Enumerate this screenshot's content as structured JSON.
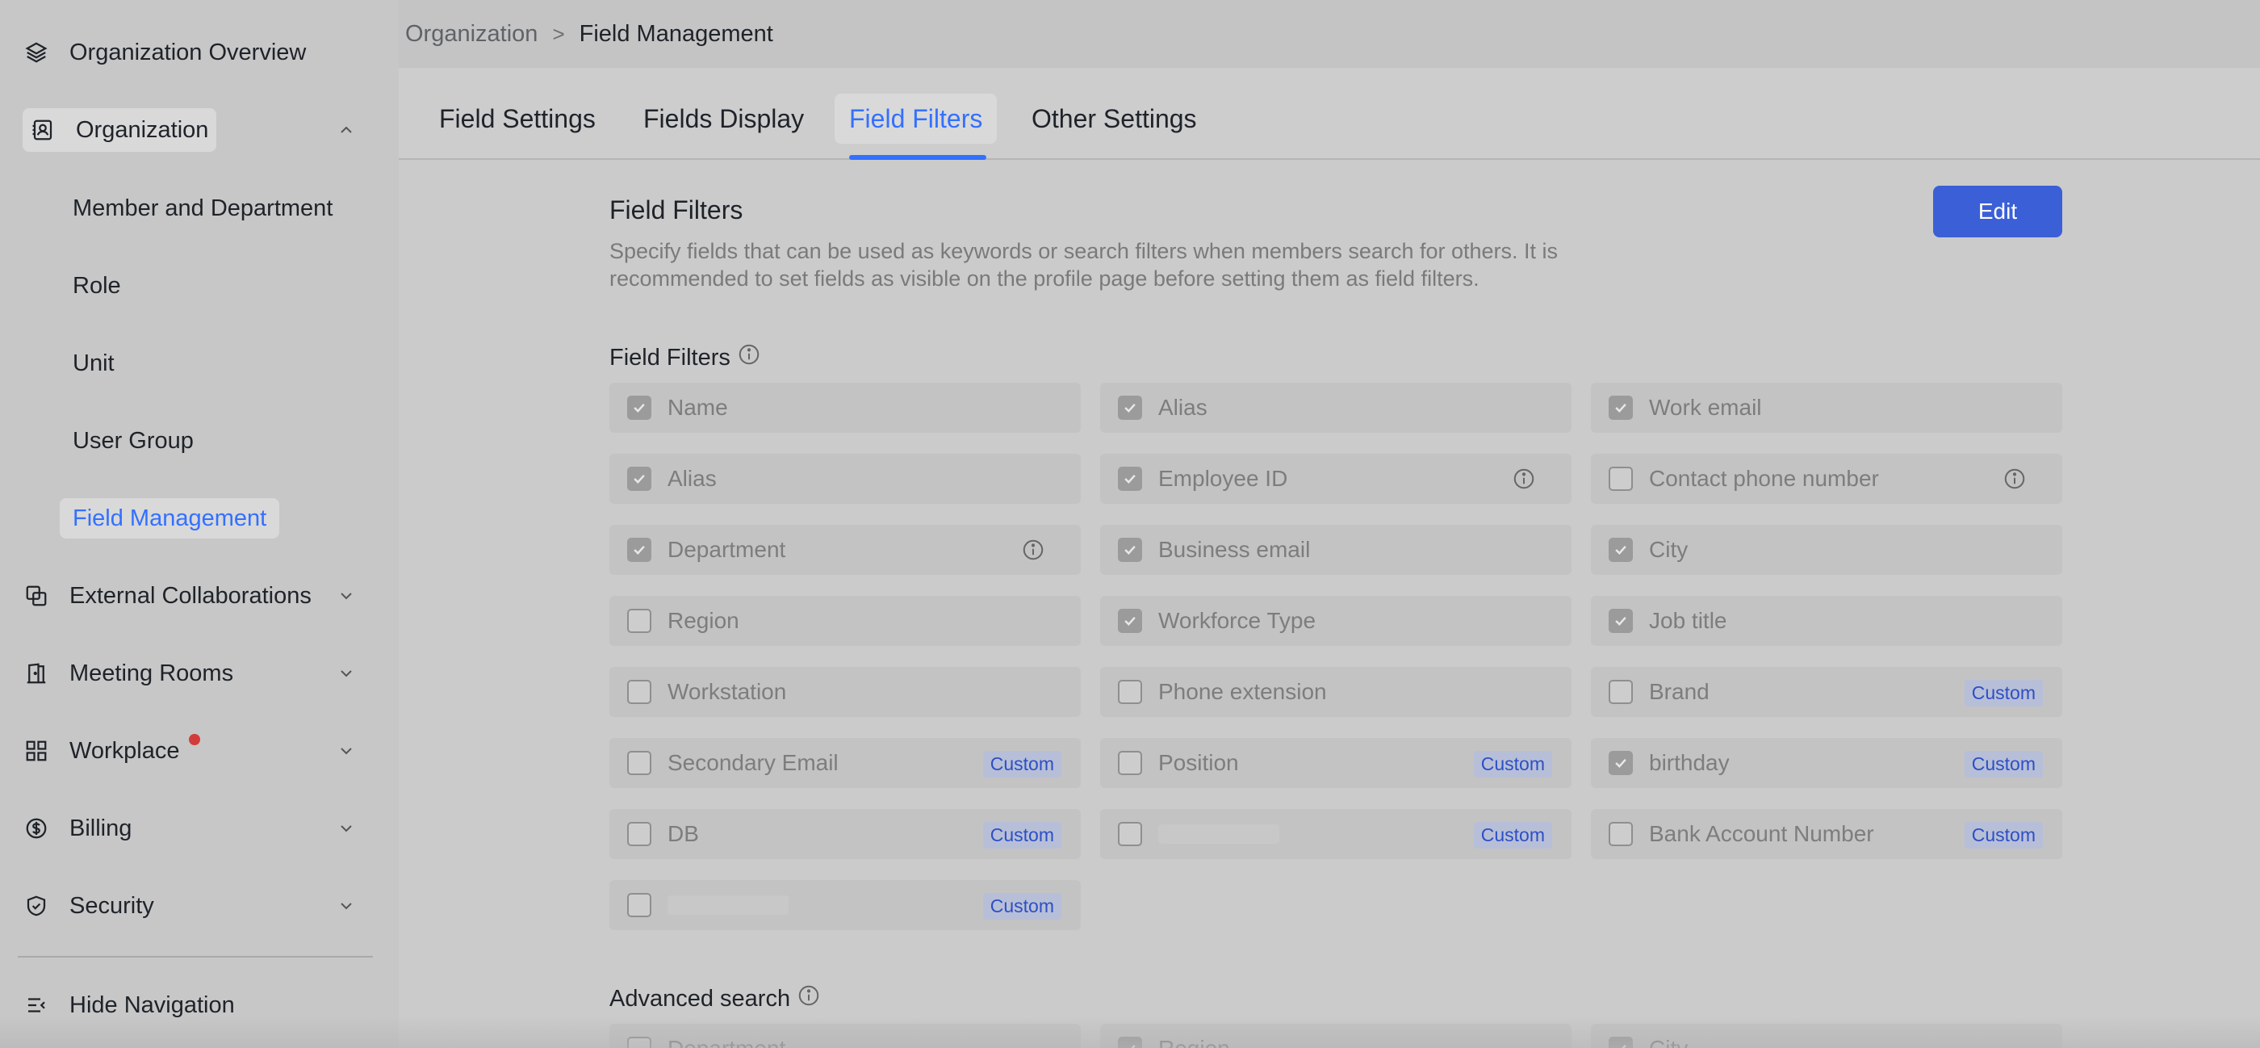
{
  "sidebar": {
    "overview": {
      "label": "Organization Overview",
      "icon": "layers-icon"
    },
    "organization": {
      "label": "Organization",
      "icon": "contact-card-icon"
    },
    "sub_items": [
      {
        "label": "Member and Department"
      },
      {
        "label": "Role"
      },
      {
        "label": "Unit"
      },
      {
        "label": "User Group"
      },
      {
        "label": "Field Management"
      }
    ],
    "groups": [
      {
        "label": "External Collaborations",
        "icon": "collab-icon"
      },
      {
        "label": "Meeting Rooms",
        "icon": "door-icon"
      },
      {
        "label": "Workplace",
        "icon": "grid-icon"
      },
      {
        "label": "Billing",
        "icon": "dollar-icon"
      },
      {
        "label": "Security",
        "icon": "shield-icon"
      }
    ],
    "hide_nav": {
      "label": "Hide Navigation",
      "icon": "collapse-icon"
    }
  },
  "breadcrumb": {
    "root": "Organization",
    "sep": ">",
    "current": "Field Management"
  },
  "tabs": [
    {
      "label": "Field Settings"
    },
    {
      "label": "Fields Display"
    },
    {
      "label": "Field Filters",
      "active": true
    },
    {
      "label": "Other Settings"
    }
  ],
  "section": {
    "title": "Field Filters",
    "description": "Specify fields that can be used as keywords or search filters when members search for others. It is recommended to set fields as visible on the profile page before setting them as field filters.",
    "edit_label": "Edit",
    "filters_title": "Field Filters",
    "advanced_title": "Advanced search",
    "custom_tag": "Custom"
  },
  "fields": [
    {
      "label": "Name",
      "checked": true
    },
    {
      "label": "Alias",
      "checked": true
    },
    {
      "label": "Work email",
      "checked": true
    },
    {
      "label": "Alias",
      "checked": true
    },
    {
      "label": "Employee ID",
      "checked": true,
      "info": true
    },
    {
      "label": "Contact phone number",
      "checked": false,
      "info": true
    },
    {
      "label": "Department",
      "checked": true,
      "info": true
    },
    {
      "label": "Business email",
      "checked": true
    },
    {
      "label": "City",
      "checked": true
    },
    {
      "label": "Region",
      "checked": false
    },
    {
      "label": "Workforce Type",
      "checked": true
    },
    {
      "label": "Job title",
      "checked": true
    },
    {
      "label": "Workstation",
      "checked": false
    },
    {
      "label": "Phone extension",
      "checked": false
    },
    {
      "label": "Brand",
      "checked": false,
      "custom": true
    },
    {
      "label": "Secondary Email",
      "checked": false,
      "custom": true
    },
    {
      "label": "Position",
      "checked": false,
      "custom": true
    },
    {
      "label": "birthday",
      "checked": true,
      "custom": true
    },
    {
      "label": "DB",
      "checked": false,
      "custom": true
    },
    {
      "label": "",
      "checked": false,
      "custom": true,
      "blurred": true
    },
    {
      "label": "Bank Account Number",
      "checked": false,
      "custom": true
    },
    {
      "label": "",
      "checked": false,
      "custom": true,
      "blurred": true
    }
  ],
  "advanced_fields": [
    {
      "label": "Department",
      "checked": false
    },
    {
      "label": "Region",
      "checked": true
    },
    {
      "label": "City",
      "checked": true
    }
  ],
  "colors": {
    "accent": "#3370ff",
    "button": "#3b5fd6",
    "tag_text": "#2e4fc4",
    "badge": "#d23c3c"
  }
}
